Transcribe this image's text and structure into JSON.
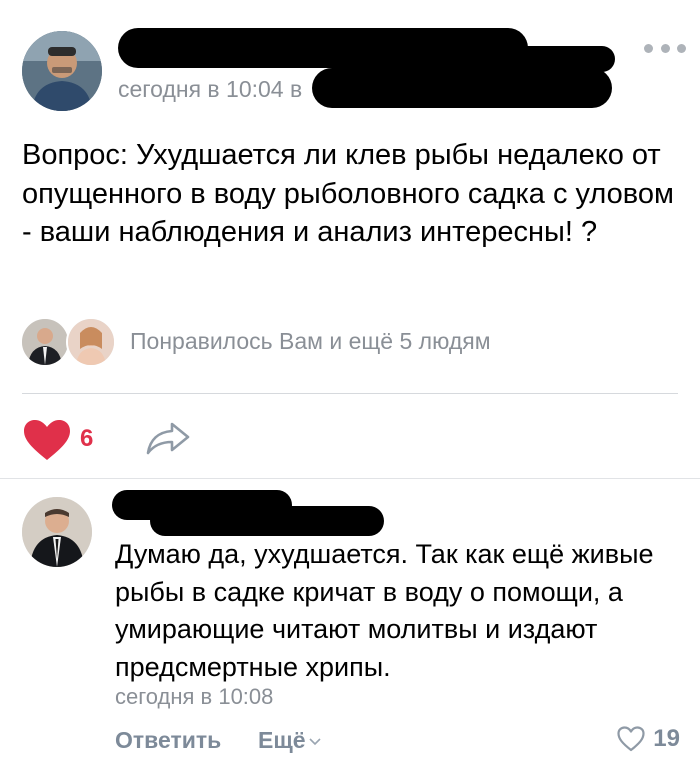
{
  "post": {
    "time": "сегодня в 10:04 в",
    "text": "Вопрос: Ухудшается ли клев рыбы недалеко от опущенного в воду рыболовного садка с уловом - ваши наблюдения и анализ интересны! ?",
    "likes_summary": "Понравилось Вам и ещё 5 людям",
    "like_count": "6",
    "icons": {
      "more": "more-dots-icon",
      "like": "heart-icon",
      "share": "share-arrow-icon"
    }
  },
  "comment": {
    "text": "Думаю да, ухудшается. Так как ещё живые рыбы в садке кричат в воду о помощи, а умирающие читают молитвы и издают предсмертные хрипы.",
    "time": "сегодня в 10:08",
    "reply_label": "Ответить",
    "more_label": "Ещё",
    "like_count": "19",
    "icons": {
      "more": "chevron-down-icon",
      "like": "heart-outline-icon"
    }
  },
  "colors": {
    "accent_red": "#e0304a",
    "muted_text": "#8a8f96",
    "action_text": "#7d8a99",
    "divider": "#d6d9dd"
  }
}
